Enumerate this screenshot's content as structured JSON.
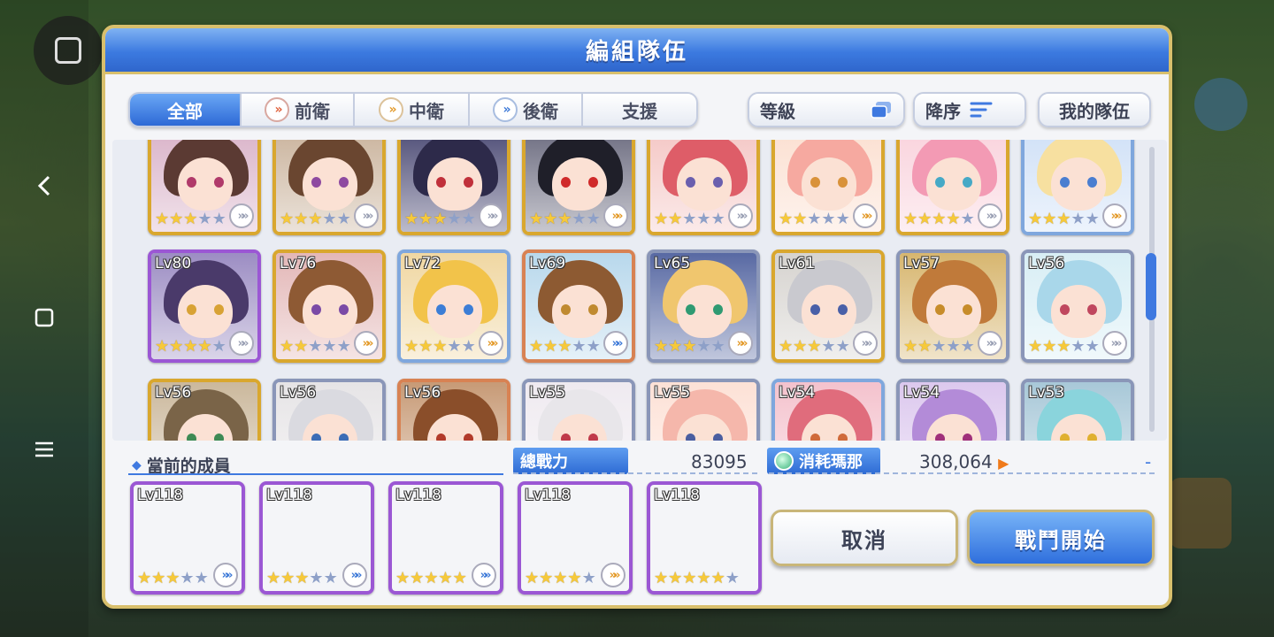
{
  "panel": {
    "title": "編組隊伍"
  },
  "tabs": [
    {
      "label": "全部",
      "active": true,
      "icon": ""
    },
    {
      "label": "前衛",
      "active": false,
      "icon": "vanguard-icon"
    },
    {
      "label": "中衛",
      "active": false,
      "icon": "midguard-icon"
    },
    {
      "label": "後衛",
      "active": false,
      "icon": "rearguard-icon"
    },
    {
      "label": "支援",
      "active": false,
      "icon": ""
    }
  ],
  "sort": {
    "level_label": "等級",
    "order_label": "降序",
    "my_team_label": "我的隊伍"
  },
  "roster_rows": [
    [
      {
        "lv": "",
        "stars": 3,
        "frame": "gold",
        "hair": "#5b3a33",
        "eye": "#b03a6a",
        "bg": "#d9b2c8",
        "role": "gray"
      },
      {
        "lv": "",
        "stars": 3,
        "frame": "gold",
        "hair": "#6a4630",
        "eye": "#8e4aa0",
        "bg": "#c9b29b",
        "role": "gray"
      },
      {
        "lv": "",
        "stars": 3,
        "frame": "gold",
        "hair": "#2d2a4a",
        "eye": "#c0303a",
        "bg": "#4b4a74",
        "role": "gray"
      },
      {
        "lv": "",
        "stars": 3,
        "frame": "gold",
        "hair": "#1f1f29",
        "eye": "#d02a2a",
        "bg": "#6a6a7e",
        "role": "orange"
      },
      {
        "lv": "",
        "stars": 2,
        "frame": "gold",
        "hair": "#de5d68",
        "eye": "#6a5fae",
        "bg": "#f4c6c4",
        "role": "gray"
      },
      {
        "lv": "",
        "stars": 2,
        "frame": "gold",
        "hair": "#f6a9a0",
        "eye": "#d9923a",
        "bg": "#fbdfd0",
        "role": "orange"
      },
      {
        "lv": "",
        "stars": 4,
        "frame": "gold",
        "hair": "#f39ab4",
        "eye": "#46a9c6",
        "bg": "#f9d2dc",
        "role": "gray"
      },
      {
        "lv": "",
        "stars": 3,
        "frame": "blue",
        "hair": "#f7e0a0",
        "eye": "#4a7ed0",
        "bg": "#cfe0f7",
        "role": "orange"
      }
    ],
    [
      {
        "lv": "Lv80",
        "stars": 4,
        "frame": "purple",
        "hair": "#4a3a6a",
        "eye": "#d8a235",
        "bg": "#9c8dc3",
        "role": "gray"
      },
      {
        "lv": "Lv76",
        "stars": 2,
        "frame": "gold",
        "hair": "#8e5a34",
        "eye": "#7b4aa6",
        "bg": "#e3b7b7",
        "role": "orange"
      },
      {
        "lv": "Lv72",
        "stars": 3,
        "frame": "blue",
        "hair": "#f2c34a",
        "eye": "#3c7ed6",
        "bg": "#f0d7a2",
        "role": "orange"
      },
      {
        "lv": "Lv69",
        "stars": 3,
        "frame": "copper",
        "hair": "#8d5a32",
        "eye": "#c08a30",
        "bg": "#b8d8ec",
        "role": "blue"
      },
      {
        "lv": "Lv65",
        "stars": 3,
        "frame": "silver",
        "hair": "#f0c66e",
        "eye": "#2f9a72",
        "bg": "#5869a3",
        "role": "orange"
      },
      {
        "lv": "Lv61",
        "stars": 3,
        "frame": "gold",
        "hair": "#c9c9cf",
        "eye": "#4960a8",
        "bg": "#d6d3cf",
        "role": "gray"
      },
      {
        "lv": "Lv57",
        "stars": 2,
        "frame": "silver",
        "hair": "#c07a3a",
        "eye": "#c78c2a",
        "bg": "#d7b66f",
        "role": "gray"
      },
      {
        "lv": "Lv56",
        "stars": 3,
        "frame": "silver",
        "hair": "#a9d7ea",
        "eye": "#c0475e",
        "bg": "#d8eef5",
        "role": "gray"
      }
    ],
    [
      {
        "lv": "Lv56",
        "stars": 0,
        "frame": "gold",
        "hair": "#7a6448",
        "eye": "#3e8a54",
        "bg": "#cbb89c",
        "role": "none"
      },
      {
        "lv": "Lv56",
        "stars": 0,
        "frame": "silver",
        "hair": "#dadae0",
        "eye": "#3b6db6",
        "bg": "#e6e4e6",
        "role": "none"
      },
      {
        "lv": "Lv56",
        "stars": 0,
        "frame": "copper",
        "hair": "#8a4e2a",
        "eye": "#b23a2a",
        "bg": "#c79a76",
        "role": "none"
      },
      {
        "lv": "Lv55",
        "stars": 0,
        "frame": "silver",
        "hair": "#e8e6ea",
        "eye": "#c03a4a",
        "bg": "#efeaf0",
        "role": "none"
      },
      {
        "lv": "Lv55",
        "stars": 0,
        "frame": "silver",
        "hair": "#f5b7ab",
        "eye": "#4a5ea0",
        "bg": "#fde1d6",
        "role": "none"
      },
      {
        "lv": "Lv54",
        "stars": 0,
        "frame": "blue",
        "hair": "#e06c7c",
        "eye": "#d06a3a",
        "bg": "#f4c2cd",
        "role": "none"
      },
      {
        "lv": "Lv54",
        "stars": 0,
        "frame": "silver",
        "hair": "#b38bd8",
        "eye": "#a0307a",
        "bg": "#dcc8ee",
        "role": "none"
      },
      {
        "lv": "Lv53",
        "stars": 0,
        "frame": "silver",
        "hair": "#8ad4dc",
        "eye": "#e0b030",
        "bg": "#a8c8d8",
        "role": "none"
      }
    ]
  ],
  "current": {
    "label": "當前的成員",
    "power_label": "總戰力",
    "power_value": "83095",
    "mana_label": "消耗瑪那",
    "mana_value": "308,064",
    "mana_extra": "-"
  },
  "members": [
    {
      "lv": "Lv118",
      "stars": 3,
      "max": 5,
      "hair": "#f59aa8",
      "eye": "#4a8fd6",
      "bg": "#f9d4da",
      "role": "blue"
    },
    {
      "lv": "Lv118",
      "stars": 3,
      "max": 5,
      "hair": "#2c2640",
      "eye": "#6a3a8a",
      "bg": "#cbbfe0",
      "role": "blue"
    },
    {
      "lv": "Lv118",
      "stars": 5,
      "max": 5,
      "hair": "#e062a0",
      "eye": "#a0305a",
      "bg": "#f2b8d4",
      "role": "blue"
    },
    {
      "lv": "Lv118",
      "stars": 4,
      "max": 5,
      "hair": "#f2d07a",
      "eye": "#4a7ed0",
      "bg": "#f4e2b6",
      "role": "orange"
    },
    {
      "lv": "Lv118",
      "stars": 5,
      "max": 6,
      "hair": "#f4d064",
      "eye": "#d0902a",
      "bg": "#f7e7b8",
      "role": ""
    }
  ],
  "buttons": {
    "cancel": "取消",
    "start": "戰鬥開始"
  },
  "colors": {
    "accent": "#3f79e0",
    "frame_gold": "#d9a72e",
    "frame_purple": "#9b57d4"
  }
}
